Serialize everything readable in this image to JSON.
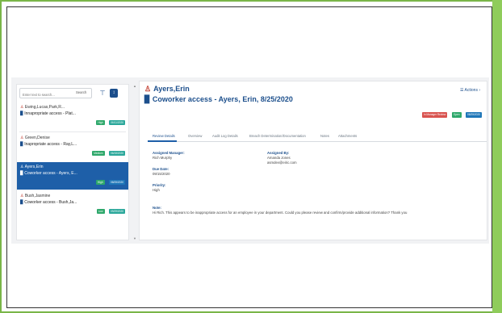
{
  "search": {
    "placeholder": "Enter text to search...",
    "button_label": "Search",
    "filter_icon": "filter-icon",
    "sort_icon": "sort-icon"
  },
  "cases": [
    {
      "person": "Ewing,Lucas,Park,R...",
      "title": "Innapropriate access - Plat...",
      "badges": [
        "High",
        "06/11/2020"
      ],
      "selected": false
    },
    {
      "person": "Green,Denise",
      "title": "Inapropriate access - Ray,L...",
      "badges": [
        "Medium",
        "06/15/2020"
      ],
      "selected": false
    },
    {
      "person": "Ayers,Erin",
      "title": "Coworker access - Ayers, E...",
      "badges": [
        "High",
        "08/25/2020"
      ],
      "selected": true
    },
    {
      "person": "Bush,Jasmine",
      "title": "Coworker access - Bush,Ja...",
      "badges": [
        "Low",
        "09/29/2020"
      ],
      "selected": false
    }
  ],
  "detail": {
    "name": "Ayers,Erin",
    "title": "Coworker access - Ayers, Erin, 8/25/2020",
    "actions_label": "☰ Actions ›",
    "status_badges": [
      "In Manager Review",
      "Open",
      "08/25/2020"
    ],
    "tabs": [
      "Review Details",
      "Overview",
      "Audit Log Details",
      "Breach Determination/Documentation",
      "Notes",
      "Attachments"
    ],
    "fields": {
      "assigned_manager_label": "Assigned Manager:",
      "assigned_manager_value": "Rich Murphy",
      "assigned_by_label": "Assigned By:",
      "assigned_by_value1": "Amanda Jones",
      "assigned_by_value2": "asmdev@eiric.com",
      "due_date_label": "Due Date:",
      "due_date_value": "09/15/2020",
      "priority_label": "Priority:",
      "priority_value": "High",
      "note_label": "Note:",
      "note_value": "Hi Rich. This appears to be inappropriate access for an employee in your department. Could you please review and confirm/provide additional information? Thank you"
    }
  },
  "colors": {
    "accent": "#1c4f8c",
    "selected_row": "#1e5fa8",
    "frame_green": "#8fcc5b",
    "person_icon": "#c0392b"
  }
}
